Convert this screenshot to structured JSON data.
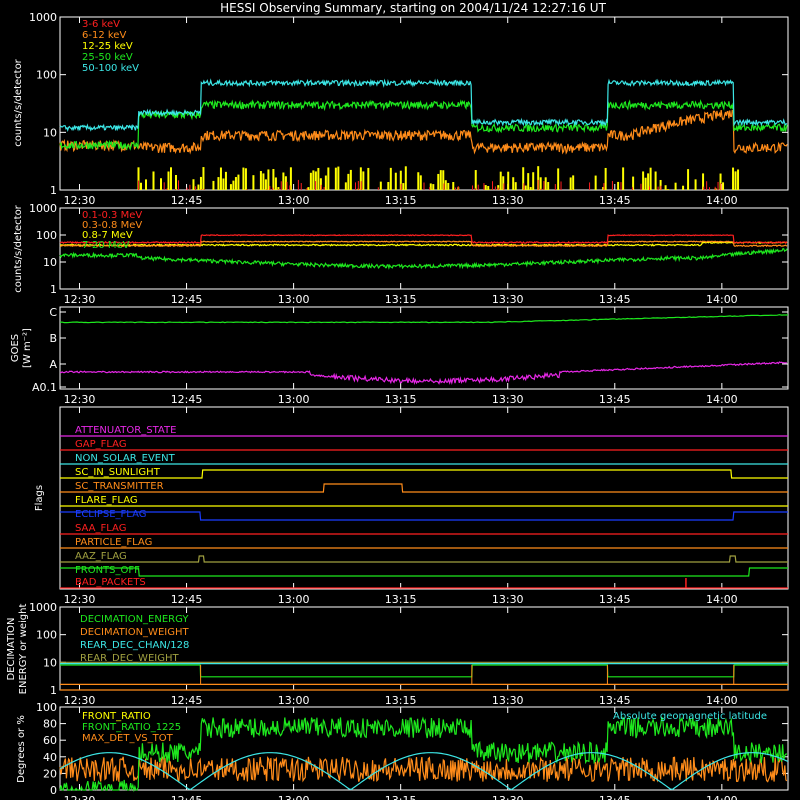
{
  "title": "HESSI Observing Summary, starting on 2004/11/24 12:27:16 UT",
  "time_ticks": [
    "12:30",
    "12:45",
    "13:00",
    "13:15",
    "13:30",
    "13:45",
    "14:00"
  ],
  "colors": {
    "background": "#000000",
    "axes": "#ffffff",
    "red": "#ff2020",
    "orange": "#ff8c1a",
    "yellow": "#ffff00",
    "green": "#1ee81e",
    "cyan": "#3ce6e6",
    "magenta": "#e628e6",
    "blue": "#1a3cff",
    "olive": "#a0a040"
  },
  "chart_data": [
    {
      "type": "line",
      "ylabel": "counts/s/detector",
      "y_scale": "log",
      "ylim": [
        1,
        1000
      ],
      "y_ticks": [
        "1",
        "10",
        "100",
        "1000"
      ],
      "x_unit": "UT time",
      "legend_position": "top-left",
      "series": [
        {
          "name": "3-6 keV",
          "color": "#ff2020"
        },
        {
          "name": "6-12 keV",
          "color": "#ff8c1a"
        },
        {
          "name": "12-25 keV",
          "color": "#ffff00"
        },
        {
          "name": "25-50 keV",
          "color": "#1ee81e"
        },
        {
          "name": "50-100 keV",
          "color": "#3ce6e6"
        }
      ]
    },
    {
      "type": "line",
      "ylabel": "counts/s/detector",
      "y_scale": "log",
      "ylim": [
        1,
        1000
      ],
      "y_ticks": [
        "1",
        "10",
        "100",
        "1000"
      ],
      "legend_position": "top-left",
      "series": [
        {
          "name": "0.1-0.3 MeV",
          "color": "#ff2020"
        },
        {
          "name": "0.3-0.8 MeV",
          "color": "#ff8c1a"
        },
        {
          "name": "0.8-7 MeV",
          "color": "#ffff00"
        },
        {
          "name": "7-20 MeV",
          "color": "#1ee81e"
        }
      ]
    },
    {
      "type": "line",
      "ylabel": "GOES",
      "ylabel_unit": "[W m⁻²]",
      "y_scale": "log",
      "y_ticks": [
        "A0.1",
        "A",
        "B",
        "C"
      ],
      "series": [
        {
          "color": "#1ee81e"
        },
        {
          "color": "#e628e6"
        }
      ]
    },
    {
      "type": "line",
      "ylabel": "Flags",
      "flags": [
        {
          "name": "ATTENUATOR_STATE",
          "color": "#e628e6"
        },
        {
          "name": "GAP_FLAG",
          "color": "#ff2020"
        },
        {
          "name": "NON_SOLAR_EVENT",
          "color": "#3ce6e6"
        },
        {
          "name": "SC_IN_SUNLIGHT",
          "color": "#ffff00"
        },
        {
          "name": "SC_TRANSMITTER",
          "color": "#ff8c1a"
        },
        {
          "name": "FLARE_FLAG",
          "color": "#ffff00"
        },
        {
          "name": "ECLIPSE_FLAG",
          "color": "#1a3cff"
        },
        {
          "name": "SAA_FLAG",
          "color": "#ff2020"
        },
        {
          "name": "PARTICLE_FLAG",
          "color": "#ff8c1a"
        },
        {
          "name": "AAZ_FLAG",
          "color": "#a0a040"
        },
        {
          "name": "FRONTS_OFF",
          "color": "#1ee81e"
        },
        {
          "name": "BAD_PACKETS",
          "color": "#ff2020"
        }
      ]
    },
    {
      "type": "line",
      "ylabel": "DECIMATION ENERGY or weight",
      "y_scale": "log",
      "ylim": [
        1,
        1000
      ],
      "y_ticks": [
        "1",
        "10",
        "100",
        "1000"
      ],
      "series": [
        {
          "name": "DECIMATION_ENERGY",
          "color": "#1ee81e"
        },
        {
          "name": "DECIMATION_WEIGHT",
          "color": "#ff8c1a"
        },
        {
          "name": "REAR_DEC_CHAN/128",
          "color": "#3ce6e6"
        },
        {
          "name": "REAR_DEC_WEIGHT",
          "color": "#a0a040"
        }
      ]
    },
    {
      "type": "line",
      "ylabel": "Degrees or %",
      "ylim": [
        0,
        100
      ],
      "y_ticks": [
        "0",
        "20",
        "40",
        "60",
        "80",
        "100"
      ],
      "annotation": "Absolute geomagnetic latitude",
      "series": [
        {
          "name": "FRONT_RATIO",
          "color": "#ffff00"
        },
        {
          "name": "FRONT_RATIO_1225",
          "color": "#1ee81e"
        },
        {
          "name": "MAX_DET_VS_TOT",
          "color": "#ff8c1a"
        },
        {
          "color": "#3ce6e6"
        }
      ]
    }
  ]
}
